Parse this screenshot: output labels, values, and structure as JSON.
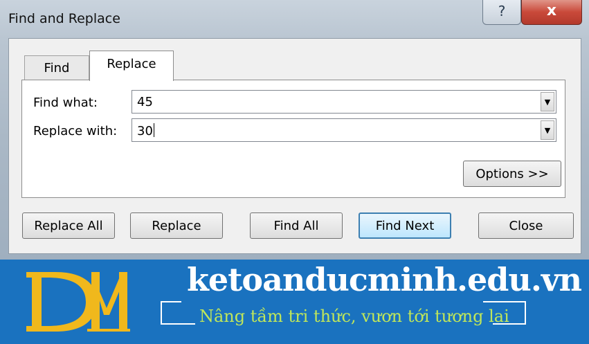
{
  "window": {
    "title": "Find and Replace",
    "help_label": "?",
    "close_label": "x"
  },
  "tabs": [
    {
      "label": "Find",
      "active": false
    },
    {
      "label": "Replace",
      "active": true
    }
  ],
  "find_what": {
    "label": "Find what:",
    "value": "45"
  },
  "replace_with": {
    "label": "Replace with:",
    "value": "30"
  },
  "options_button": "Options >>",
  "buttons": {
    "replace_all": "Replace All",
    "replace": "Replace",
    "find_all": "Find All",
    "find_next": "Find Next",
    "close": "Close"
  },
  "banner": {
    "site": "ketoanducminh.edu.vn",
    "slogan": "Nâng tầm tri thức, vươn tới tương lai",
    "logo_text": "DM",
    "background_color": "#1a72bf",
    "slogan_color": "#bfe65a",
    "logo_color": "#f0b81c"
  },
  "colors": {
    "default_button_border": "#3c7fb1",
    "close_button": "#c9493a"
  }
}
